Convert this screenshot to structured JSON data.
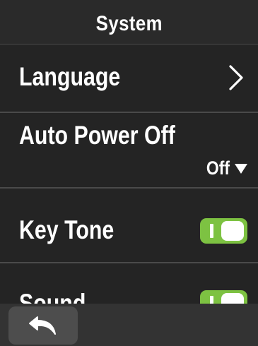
{
  "header": {
    "title": "System"
  },
  "settings": {
    "language": {
      "label": "Language",
      "icon": "chevron-right-icon"
    },
    "auto_power_off": {
      "label": "Auto Power Off",
      "value": "Off",
      "icon": "dropdown-triangle-icon"
    },
    "key_tone": {
      "label": "Key Tone",
      "enabled": true
    },
    "sound": {
      "label": "Sound",
      "enabled": true
    }
  },
  "footer": {
    "back_icon": "back-arrow-icon"
  },
  "colors": {
    "background": "#242424",
    "toggle_on": "#7dc242",
    "divider": "#4a4a4a",
    "bottom_bar": "#333333",
    "button": "#4d4d4d"
  }
}
